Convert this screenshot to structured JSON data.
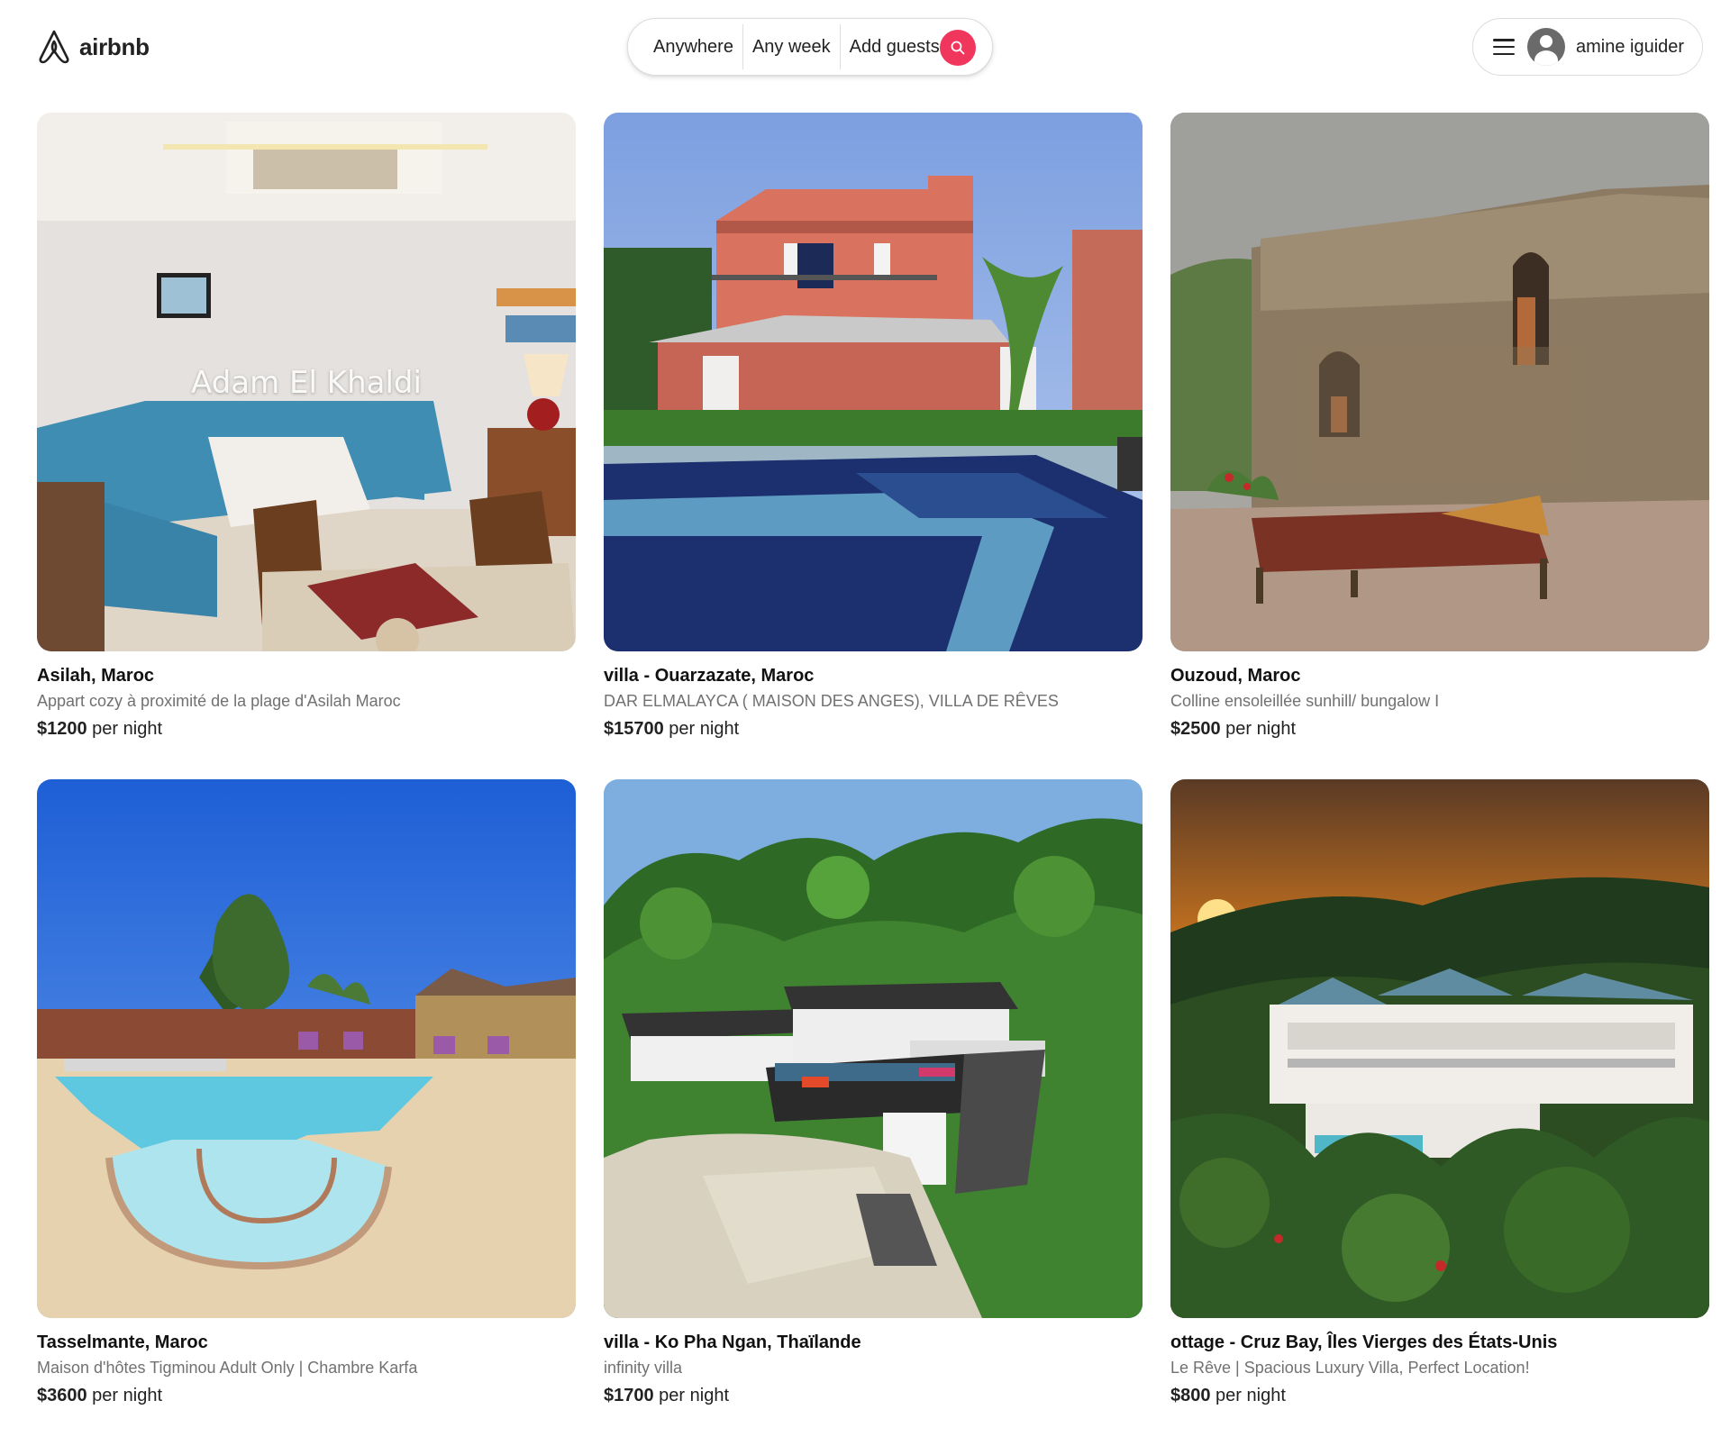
{
  "brand": {
    "name": "airbnb"
  },
  "search": {
    "where": "Anywhere",
    "when": "Any week",
    "who": "Add guests"
  },
  "user": {
    "name": "amine iguider"
  },
  "colors": {
    "accent": "#f1365d",
    "muted": "#717171"
  },
  "listings": [
    {
      "title": "Asilah, Maroc",
      "subtitle": "Appart cozy à proximité de la plage d'Asilah Maroc",
      "price": "$1200",
      "price_suffix": " per night",
      "watermark": "Adam El Khaldi",
      "photo": "living-room-interior"
    },
    {
      "title": "villa - Ouarzazate, Maroc",
      "subtitle": "DAR ELMALAYCA ( MAISON DES ANGES), VILLA DE RÊVES",
      "price": "$15700",
      "price_suffix": " per night",
      "photo": "pink-villa-with-pool"
    },
    {
      "title": "Ouzoud, Maroc",
      "subtitle": "Colline ensoleillée sunhill/ bungalow I",
      "price": "$2500",
      "price_suffix": " per night",
      "photo": "stone-wall-with-daybed"
    },
    {
      "title": "Tasselmante, Maroc",
      "subtitle": "Maison d'hôtes Tigminou Adult Only | Chambre Karfa",
      "price": "$3600",
      "price_suffix": " per night",
      "photo": "desert-pool"
    },
    {
      "title": "villa - Ko Pha Ngan, Thaïlande",
      "subtitle": "infinity villa",
      "price": "$1700",
      "price_suffix": " per night",
      "photo": "jungle-infinity-villa"
    },
    {
      "title": "ottage - Cruz Bay, Îles Vierges des États-Unis",
      "subtitle": "Le Rêve | Spacious Luxury Villa, Perfect Location!",
      "price": "$800",
      "price_suffix": " per night",
      "photo": "sunset-luxury-villa"
    }
  ]
}
